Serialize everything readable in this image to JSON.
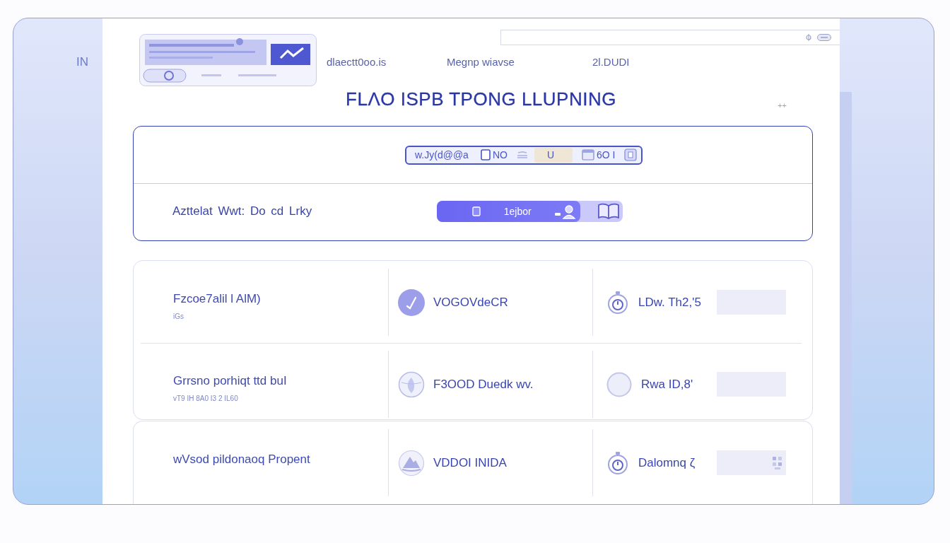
{
  "sidebar": {
    "label": "IN"
  },
  "header": {
    "nav": [
      {
        "label": "dlaectt0oo.is"
      },
      {
        "label": "Megnp wiavse"
      },
      {
        "label": "2l.DUDI"
      }
    ]
  },
  "title": "FLΛO ISPB TPONG LLUPNING",
  "title_mark": "++",
  "settings_card": {
    "toolbar": [
      {
        "kind": "text",
        "label": "w.Jy(d@@a",
        "selected": false
      },
      {
        "kind": "icon_label",
        "label": "NO",
        "selected": false
      },
      {
        "kind": "icon",
        "selected": false
      },
      {
        "kind": "text",
        "label": "U",
        "selected": true
      },
      {
        "kind": "icon_label",
        "label": "6O I",
        "selected": false
      },
      {
        "kind": "icon",
        "selected": false
      }
    ],
    "row": {
      "label": "Azttelat Wwt: Do cd Lrky",
      "progress": {
        "label": "1ejbor",
        "level": 0.77
      }
    }
  },
  "cards": [
    {
      "rows": [
        {
          "title": "Fzcoe7alil l AlM)",
          "subtitle": "iGs",
          "column_2": "VOGOVdeCR",
          "column_3": "LDw. Th2,'5"
        },
        {
          "title": "Grrsno porhiqt ttd buI",
          "subtitle": "vT9 IH 8A0 I3 2 IL60",
          "column_2": "F3OOD Duedk wv.",
          "column_3": "Rwa ID,8'"
        }
      ]
    },
    {
      "rows": [
        {
          "title": "wVsod pildonaoq Propent",
          "column_2": "VDDOI INIDA",
          "column_3": "Dalomnq ζ"
        }
      ]
    }
  ]
}
